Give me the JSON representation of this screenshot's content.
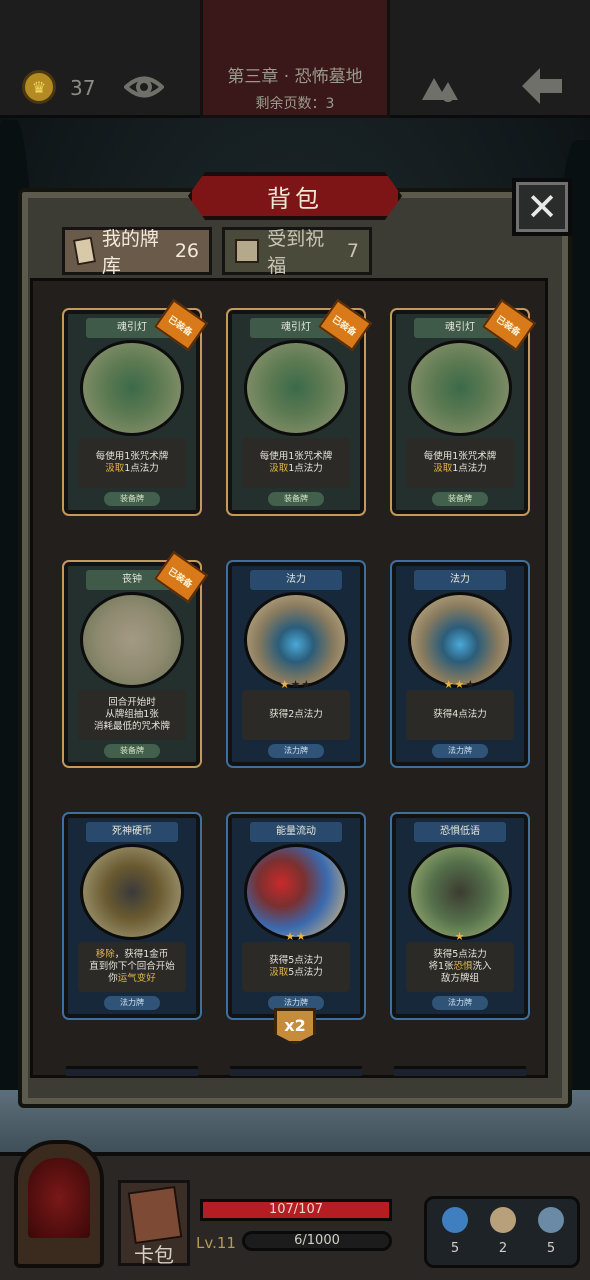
{
  "header": {
    "gold": "37",
    "chapter_title": "第三章 · 恐怖墓地",
    "pages_left": "剩余页数：3"
  },
  "dialog": {
    "title": "背包",
    "close": "✕",
    "tabs": [
      {
        "label": "我的牌库",
        "count": "26"
      },
      {
        "label": "受到祝福",
        "count": "7"
      }
    ]
  },
  "cards": [
    {
      "name": "魂引灯",
      "badge": "已装备",
      "desc1": "每使用1张咒术牌",
      "desc2_hl": "汲取",
      "desc2": "1点法力",
      "desc3": "",
      "type": "装备牌"
    },
    {
      "name": "魂引灯",
      "badge": "已装备",
      "desc1": "每使用1张咒术牌",
      "desc2_hl": "汲取",
      "desc2": "1点法力",
      "desc3": "",
      "type": "装备牌"
    },
    {
      "name": "魂引灯",
      "badge": "已装备",
      "desc1": "每使用1张咒术牌",
      "desc2_hl": "汲取",
      "desc2": "1点法力",
      "desc3": "",
      "type": "装备牌"
    },
    {
      "name": "丧钟",
      "badge": "已装备",
      "desc1": "回合开始时",
      "desc2_hl": "",
      "desc2": "从牌组抽1张",
      "desc3": "消耗最低的咒术牌",
      "type": "装备牌"
    },
    {
      "name": "法力",
      "badge": "",
      "desc1": "获得2点法力",
      "desc2_hl": "",
      "desc2": "",
      "desc3": "",
      "type": "法力牌",
      "stars": 1
    },
    {
      "name": "法力",
      "badge": "",
      "desc1": "获得4点法力",
      "desc2_hl": "",
      "desc2": "",
      "desc3": "",
      "type": "法力牌",
      "stars": 2
    },
    {
      "name": "死神硬币",
      "badge": "",
      "desc1_hl": "移除",
      "desc1": "，获得1金币",
      "desc2_hl": "",
      "desc2": "直到你下个回合开始",
      "desc3_pre": "你",
      "desc3_hl": "运气变好",
      "type": "法力牌"
    },
    {
      "name": "能量流动",
      "badge": "",
      "desc1": "获得5点法力",
      "desc2_hl": "汲取",
      "desc2": "5点法力",
      "desc3": "",
      "type": "法力牌",
      "stars": 2
    },
    {
      "name": "恐惧低语",
      "badge": "",
      "desc1": "获得5点法力",
      "desc2_pre": "将1张",
      "desc2_hl": "恐惧",
      "desc2": "洗入",
      "desc3": "敌方牌组",
      "type": "法力牌",
      "stars": 1
    }
  ],
  "multiplier": "x2",
  "hud": {
    "deck_label": "卡包",
    "hp": "107/107",
    "hp_ratio": 1.0,
    "level": "Lv.11",
    "xp": "6/1000",
    "resources": [
      {
        "name": "mana-orb",
        "value": "5",
        "color": "#3f7fc0"
      },
      {
        "name": "hourglass",
        "value": "2",
        "color": "#b8a07a"
      },
      {
        "name": "cards",
        "value": "5",
        "color": "#6a8aa6"
      }
    ]
  }
}
